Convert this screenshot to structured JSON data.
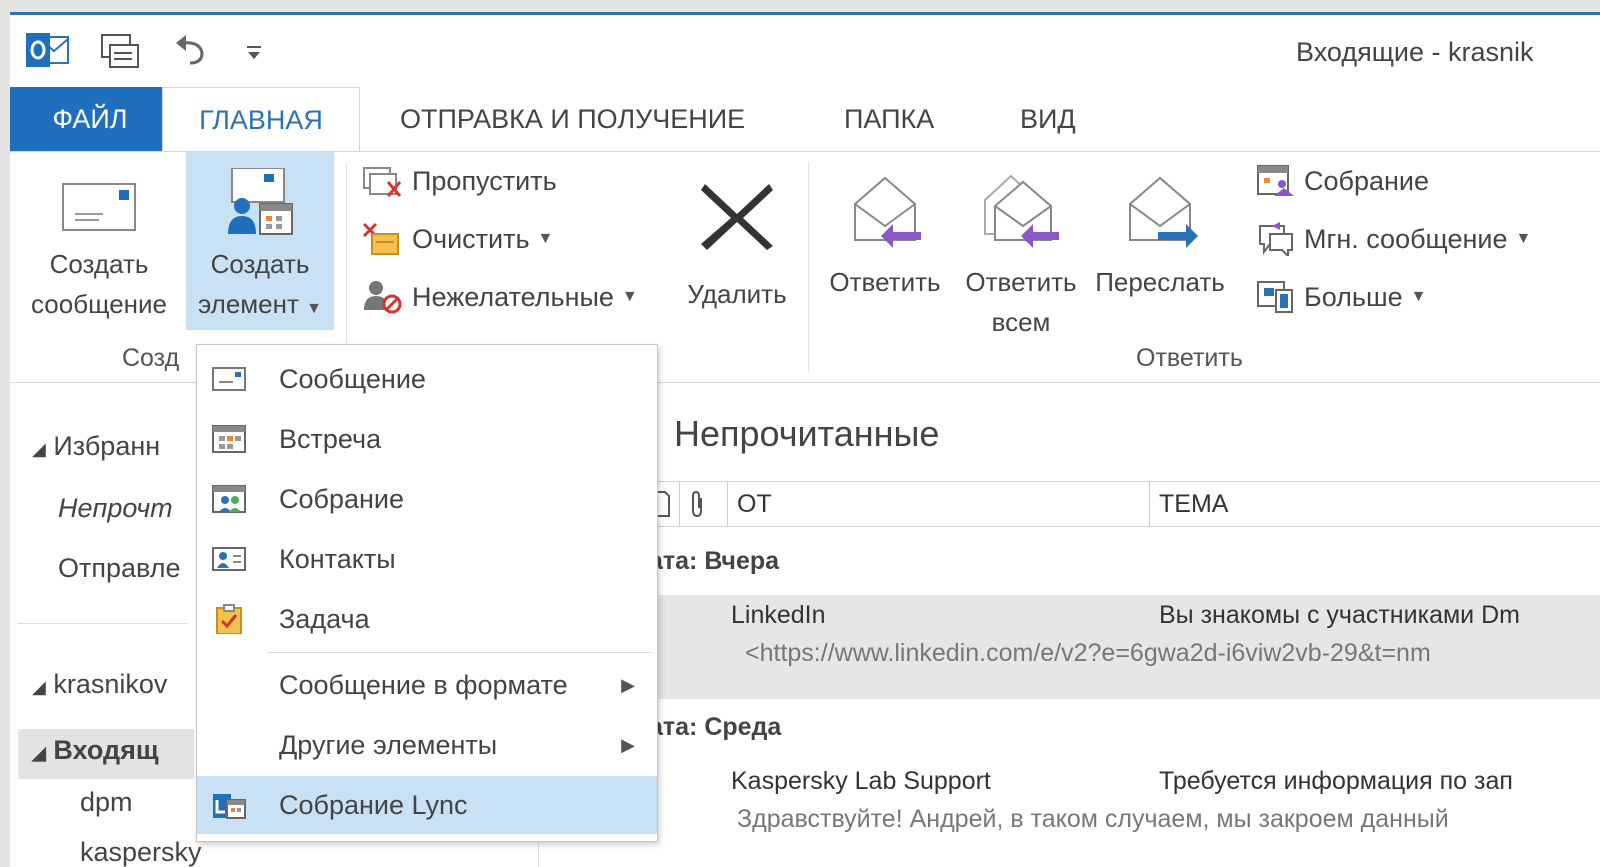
{
  "window": {
    "title": "Входящие - krasnik"
  },
  "tabs": [
    "ФАЙЛ",
    "ГЛАВНАЯ",
    "ОТПРАВКА И ПОЛУЧЕНИЕ",
    "ПАПКА",
    "ВИД"
  ],
  "ribbon": {
    "new_message": [
      "Создать",
      "сообщение"
    ],
    "new_item": [
      "Создать",
      "элемент"
    ],
    "group_create": "Созд",
    "ignore": "Пропустить",
    "clean": "Очистить",
    "junk": "Нежелательные",
    "delete": "Удалить",
    "reply": "Ответить",
    "reply_all": [
      "Ответить",
      "всем"
    ],
    "forward": "Переслать",
    "meeting": "Собрание",
    "im": "Мгн. сообщение",
    "more": "Больше",
    "group_reply": "Ответить"
  },
  "nav": {
    "favorites": "Избранн",
    "unread": "Непрочт",
    "sent": "Отправле",
    "account": "krasnikov",
    "inbox": "Входящ",
    "dpm": "dpm",
    "kaspersky": "kaspersky"
  },
  "list": {
    "title": "Непрочитанные",
    "col_from": "ОТ",
    "col_subject": "ТЕМА",
    "group1": "ата: Вчера",
    "group2": "ата: Среда",
    "rows": [
      {
        "from": "LinkedIn",
        "subject": "Вы знакомы с участниками Dm",
        "preview": "<https://www.linkedin.com/e/v2?e=6gwa2d-i6viw2vb-29&t=nm"
      },
      {
        "from": "Kaspersky Lab Support",
        "subject": "Требуется информация по зап",
        "preview": "Здравствуйте!  Андрей, в таком случаем, мы закроем данный"
      }
    ]
  },
  "menu": {
    "items": [
      "Сообщение",
      "Встреча",
      "Собрание",
      "Контакты",
      "Задача",
      "Сообщение в формате",
      "Другие элементы",
      "Собрание Lync"
    ]
  },
  "colors": {
    "accent": "#1f6fbc",
    "highlight": "#c9e1f5"
  }
}
